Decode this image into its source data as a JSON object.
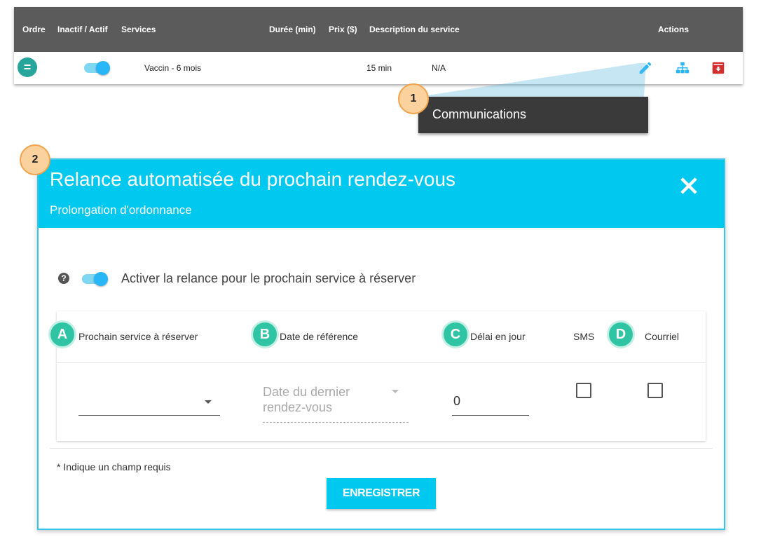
{
  "table": {
    "columns": {
      "order": "Ordre",
      "active": "Inactif / Actif",
      "services": "Services",
      "duration": "Durée (min)",
      "price": "Prix ($)",
      "description": "Description du service",
      "actions": "Actions"
    },
    "rows": [
      {
        "service": "Vaccin - 6 mois",
        "duration": "15 min",
        "description": "N/A",
        "active": true
      }
    ]
  },
  "callout_1": {
    "badge": "1",
    "tooltip": "Communications"
  },
  "callout_2": {
    "badge": "2"
  },
  "modal": {
    "title": "Relance automatisée du prochain rendez-vous",
    "subtitle": "Prolongation d'ordonnance",
    "toggle_label": "Activer la relance pour le prochain service à réserver",
    "toggle_on": true,
    "columns": {
      "next_service": "Prochain service à réserver",
      "reference_date": "Date de référence",
      "delay": "Délai en jour",
      "sms": "SMS",
      "email": "Courriel"
    },
    "badges": {
      "a": "A",
      "b": "B",
      "c": "C",
      "d": "D"
    },
    "fields": {
      "next_service_value": "",
      "reference_date_line1": "Date du dernier",
      "reference_date_line2": "rendez-vous",
      "delay_value": "0",
      "sms_checked": false,
      "email_checked": false
    },
    "required_note": "* Indique un champ requis",
    "save_label": "ENREGISTRER"
  },
  "colors": {
    "header_bg": "#5b5b5b",
    "modal_accent": "#00c8ef",
    "toggle": "#29b6f6",
    "letter_badge": "#2ec4a4",
    "number_badge": "#fbd29d",
    "archive_icon": "#d32f2f"
  }
}
